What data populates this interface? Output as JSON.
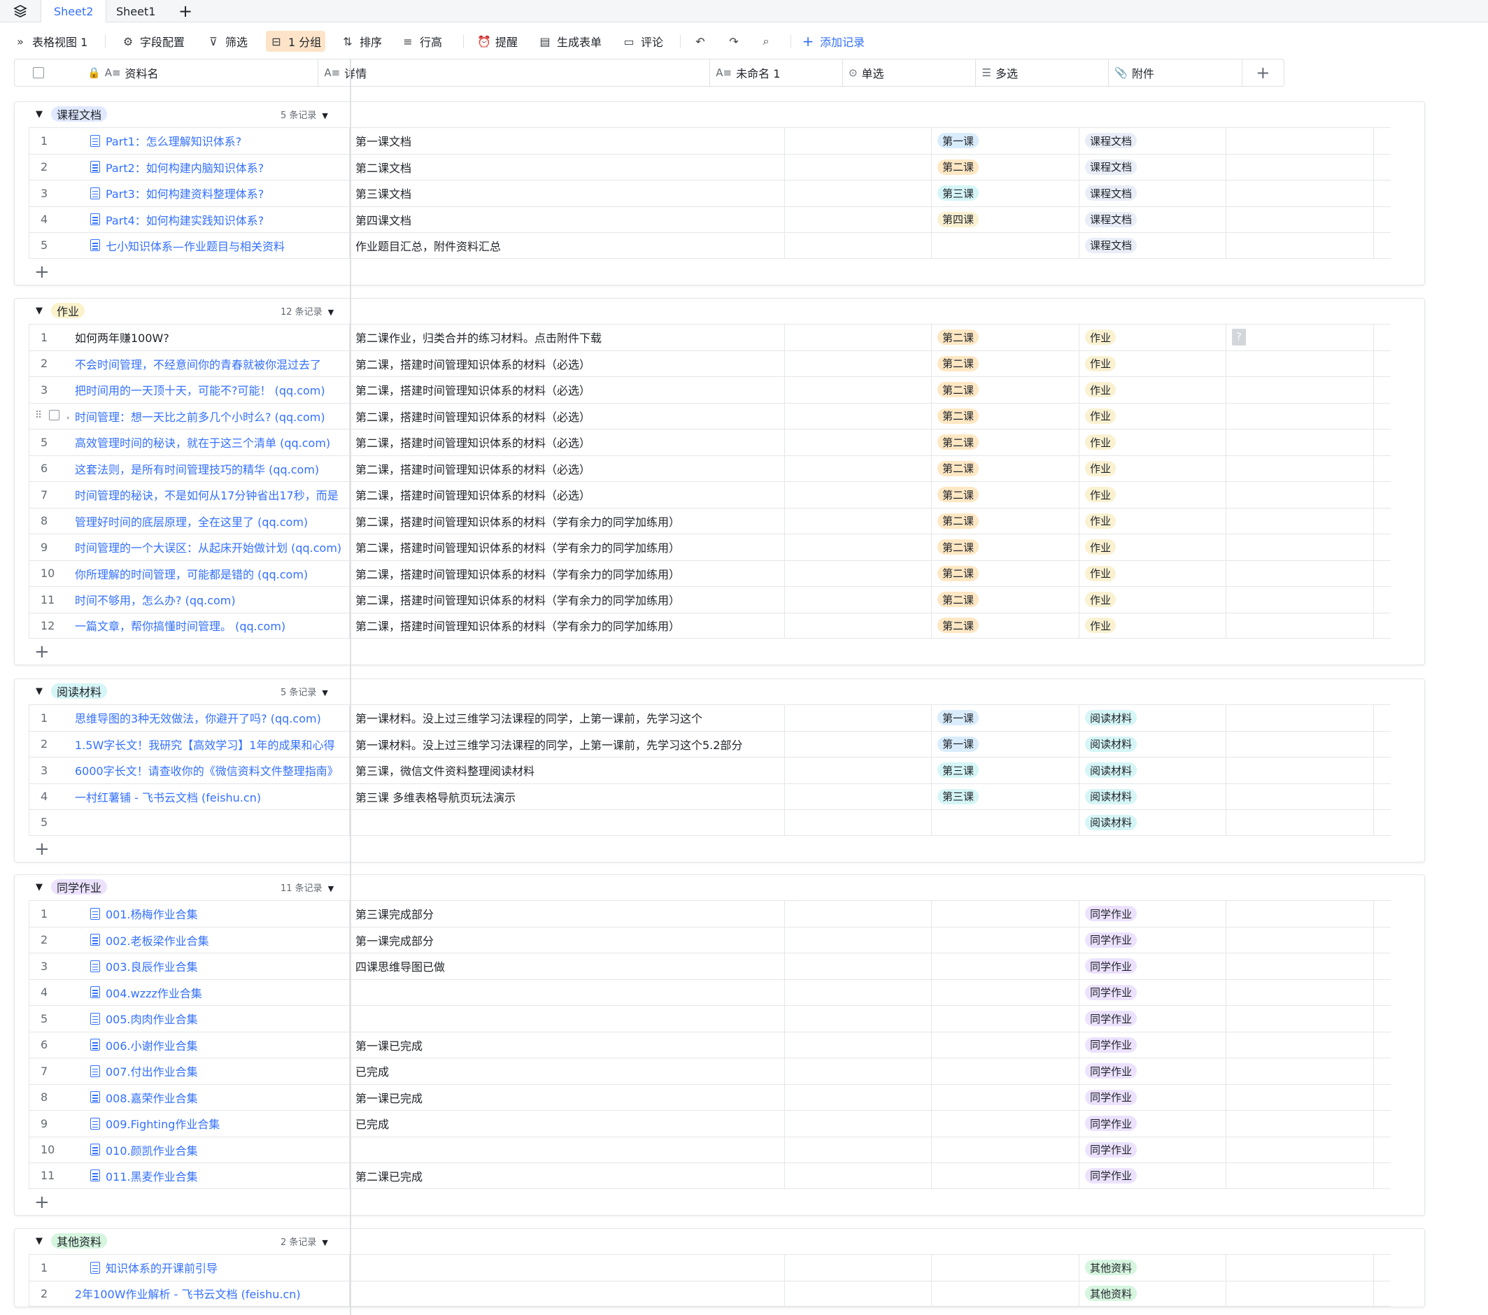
{
  "tabs": {
    "sheet2": "Sheet2",
    "sheet1": "Sheet1"
  },
  "toolbar": {
    "view_name": "表格视图 1",
    "field_config": "字段配置",
    "filter": "筛选",
    "group": "1 分组",
    "sort": "排序",
    "row_height": "行高",
    "reminder": "提醒",
    "form": "生成表单",
    "comment": "评论",
    "add_record": "添加记录"
  },
  "columns": {
    "name": "资料名",
    "detail": "详情",
    "unnamed": "未命名 1",
    "single": "单选",
    "multi": "多选",
    "attachment": "附件"
  },
  "colors": {
    "accent": "#3370ff",
    "group_active": "#fde4c8"
  },
  "groups": [
    {
      "tag": "课程文档",
      "count": "5 条记录",
      "tag_class": "t-doc",
      "rows": [
        {
          "num": "1",
          "name": "Part1：怎么理解知识体系?",
          "doc": true,
          "detail": "第一课文档",
          "single": "第一课",
          "single_cls": "p-blue",
          "multi": "课程文档",
          "multi_cls": "p-gray"
        },
        {
          "num": "2",
          "name": "Part2：如何构建内脑知识体系?",
          "doc": true,
          "detail": "第二课文档",
          "single": "第二课",
          "single_cls": "p-orange",
          "multi": "课程文档",
          "multi_cls": "p-gray"
        },
        {
          "num": "3",
          "name": "Part3：如何构建资料整理体系?",
          "doc": true,
          "detail": "第三课文档",
          "single": "第三课",
          "single_cls": "p-cyan",
          "multi": "课程文档",
          "multi_cls": "p-gray"
        },
        {
          "num": "4",
          "name": "Part4：如何构建实践知识体系?",
          "doc": true,
          "detail": "第四课文档",
          "single": "第四课",
          "single_cls": "p-yellow",
          "multi": "课程文档",
          "multi_cls": "p-gray"
        },
        {
          "num": "5",
          "name": "七小知识体系—作业题目与相关资料",
          "doc": true,
          "detail": "作业题目汇总，附件资料汇总",
          "single": "",
          "single_cls": "",
          "multi": "课程文档",
          "multi_cls": "p-gray"
        }
      ]
    },
    {
      "tag": "作业",
      "count": "12 条记录",
      "tag_class": "t-hw",
      "rows": [
        {
          "num": "1",
          "name": "如何两年赚100W?",
          "plain": true,
          "detail": "第二课作业，归类合并的练习材料。点击附件下载",
          "single": "第二课",
          "single_cls": "p-orange",
          "multi": "作业",
          "multi_cls": "p-yellow",
          "attach": true
        },
        {
          "num": "2",
          "name": "不会时间管理，不经意间你的青春就被你混过去了",
          "detail": "第二课，搭建时间管理知识体系的材料（必选）",
          "single": "第二课",
          "single_cls": "p-orange",
          "multi": "作业",
          "multi_cls": "p-yellow"
        },
        {
          "num": "3",
          "name": "把时间用的一天顶十天，可能不?可能！ (qq.com)",
          "detail": "第二课，搭建时间管理知识体系的材料（必选）",
          "single": "第二课",
          "single_cls": "p-orange",
          "multi": "作业",
          "multi_cls": "p-yellow"
        },
        {
          "num": "",
          "name": "时间管理：想一天比之前多几个小时么? (qq.com)",
          "detail": "第二课，搭建时间管理知识体系的材料（必选）",
          "single": "第二课",
          "single_cls": "p-orange",
          "multi": "作业",
          "multi_cls": "p-yellow",
          "hover": true
        },
        {
          "num": "5",
          "name": "高效管理时间的秘诀，就在于这三个清单 (qq.com)",
          "detail": "第二课，搭建时间管理知识体系的材料（必选）",
          "single": "第二课",
          "single_cls": "p-orange",
          "multi": "作业",
          "multi_cls": "p-yellow"
        },
        {
          "num": "6",
          "name": "这套法则，是所有时间管理技巧的精华 (qq.com)",
          "detail": "第二课，搭建时间管理知识体系的材料（必选）",
          "single": "第二课",
          "single_cls": "p-orange",
          "multi": "作业",
          "multi_cls": "p-yellow"
        },
        {
          "num": "7",
          "name": "时间管理的秘诀，不是如何从17分钟省出17秒，而是",
          "detail": "第二课，搭建时间管理知识体系的材料（必选）",
          "single": "第二课",
          "single_cls": "p-orange",
          "multi": "作业",
          "multi_cls": "p-yellow"
        },
        {
          "num": "8",
          "name": "管理好时间的底层原理，全在这里了 (qq.com)",
          "detail": "第二课，搭建时间管理知识体系的材料（学有余力的同学加练用）",
          "single": "第二课",
          "single_cls": "p-orange",
          "multi": "作业",
          "multi_cls": "p-yellow"
        },
        {
          "num": "9",
          "name": "时间管理的一个大误区：从起床开始做计划 (qq.com)",
          "detail": "第二课，搭建时间管理知识体系的材料（学有余力的同学加练用）",
          "single": "第二课",
          "single_cls": "p-orange",
          "multi": "作业",
          "multi_cls": "p-yellow"
        },
        {
          "num": "10",
          "name": "你所理解的时间管理，可能都是错的 (qq.com)",
          "detail": "第二课，搭建时间管理知识体系的材料（学有余力的同学加练用）",
          "single": "第二课",
          "single_cls": "p-orange",
          "multi": "作业",
          "multi_cls": "p-yellow"
        },
        {
          "num": "11",
          "name": "时间不够用，怎么办? (qq.com)",
          "detail": "第二课，搭建时间管理知识体系的材料（学有余力的同学加练用）",
          "single": "第二课",
          "single_cls": "p-orange",
          "multi": "作业",
          "multi_cls": "p-yellow"
        },
        {
          "num": "12",
          "name": "一篇文章，帮你搞懂时间管理。 (qq.com)",
          "detail": "第二课，搭建时间管理知识体系的材料（学有余力的同学加练用）",
          "single": "第二课",
          "single_cls": "p-orange",
          "multi": "作业",
          "multi_cls": "p-yellow"
        }
      ]
    },
    {
      "tag": "阅读材料",
      "count": "5 条记录",
      "tag_class": "t-read",
      "rows": [
        {
          "num": "1",
          "name": "思维导图的3种无效做法，你避开了吗? (qq.com)",
          "detail": "第一课材料。没上过三维学习法课程的同学，上第一课前，先学习这个",
          "single": "第一课",
          "single_cls": "p-blue",
          "multi": "阅读材料",
          "multi_cls": "p-cyan"
        },
        {
          "num": "2",
          "name": "1.5W字长文！我研究【高效学习】1年的成果和心得",
          "detail": "第一课材料。没上过三维学习法课程的同学，上第一课前，先学习这个5.2部分",
          "single": "第一课",
          "single_cls": "p-blue",
          "multi": "阅读材料",
          "multi_cls": "p-cyan"
        },
        {
          "num": "3",
          "name": "6000字长文！请查收你的《微信资料文件整理指南》",
          "detail": "第三课，微信文件资料整理阅读材料",
          "single": "第三课",
          "single_cls": "p-cyan",
          "multi": "阅读材料",
          "multi_cls": "p-cyan"
        },
        {
          "num": "4",
          "name": "一村红薯铺 - 飞书云文档 (feishu.cn)",
          "detail": "第三课 多维表格导航页玩法演示",
          "single": "第三课",
          "single_cls": "p-cyan",
          "multi": "阅读材料",
          "multi_cls": "p-cyan"
        },
        {
          "num": "5",
          "name": "",
          "detail": "",
          "single": "",
          "single_cls": "",
          "multi": "阅读材料",
          "multi_cls": "p-cyan"
        }
      ]
    },
    {
      "tag": "同学作业",
      "count": "11 条记录",
      "tag_class": "t-peer",
      "rows": [
        {
          "num": "1",
          "name": "001.杨梅作业合集",
          "doc": true,
          "detail": "第三课完成部分",
          "single": "",
          "single_cls": "",
          "multi": "同学作业",
          "multi_cls": "p-violet"
        },
        {
          "num": "2",
          "name": "002.老板梁作业合集",
          "doc": true,
          "detail": "第一课完成部分",
          "single": "",
          "single_cls": "",
          "multi": "同学作业",
          "multi_cls": "p-violet"
        },
        {
          "num": "3",
          "name": "003.良辰作业合集",
          "doc": true,
          "detail": "四课思维导图已做",
          "single": "",
          "single_cls": "",
          "multi": "同学作业",
          "multi_cls": "p-violet"
        },
        {
          "num": "4",
          "name": "004.wzzz作业合集",
          "doc": true,
          "detail": "",
          "single": "",
          "single_cls": "",
          "multi": "同学作业",
          "multi_cls": "p-violet"
        },
        {
          "num": "5",
          "name": "005.肉肉作业合集",
          "doc": true,
          "detail": "",
          "single": "",
          "single_cls": "",
          "multi": "同学作业",
          "multi_cls": "p-violet"
        },
        {
          "num": "6",
          "name": "006.小谢作业合集",
          "doc": true,
          "detail": "第一课已完成",
          "single": "",
          "single_cls": "",
          "multi": "同学作业",
          "multi_cls": "p-violet"
        },
        {
          "num": "7",
          "name": "007.付出作业合集",
          "doc": true,
          "detail": "已完成",
          "single": "",
          "single_cls": "",
          "multi": "同学作业",
          "multi_cls": "p-violet"
        },
        {
          "num": "8",
          "name": "008.嘉荣作业合集",
          "doc": true,
          "detail": "第一课已完成",
          "single": "",
          "single_cls": "",
          "multi": "同学作业",
          "multi_cls": "p-violet"
        },
        {
          "num": "9",
          "name": "009.Fighting作业合集",
          "doc": true,
          "detail": "已完成",
          "single": "",
          "single_cls": "",
          "multi": "同学作业",
          "multi_cls": "p-violet"
        },
        {
          "num": "10",
          "name": "010.颜凯作业合集",
          "doc": true,
          "detail": "",
          "single": "",
          "single_cls": "",
          "multi": "同学作业",
          "multi_cls": "p-violet"
        },
        {
          "num": "11",
          "name": "011.黑麦作业合集",
          "doc": true,
          "detail": "第二课已完成",
          "single": "",
          "single_cls": "",
          "multi": "同学作业",
          "multi_cls": "p-violet"
        }
      ]
    },
    {
      "tag": "其他资料",
      "count": "2 条记录",
      "tag_class": "t-other",
      "rows": [
        {
          "num": "1",
          "name": "知识体系的开课前引导",
          "doc": true,
          "detail": "",
          "single": "",
          "single_cls": "",
          "multi": "其他资料",
          "multi_cls": "p-green"
        },
        {
          "num": "2",
          "name": "2年100W作业解析 - 飞书云文档 (feishu.cn)",
          "detail": "",
          "single": "",
          "single_cls": "",
          "multi": "其他资料",
          "multi_cls": "p-green"
        }
      ]
    }
  ]
}
